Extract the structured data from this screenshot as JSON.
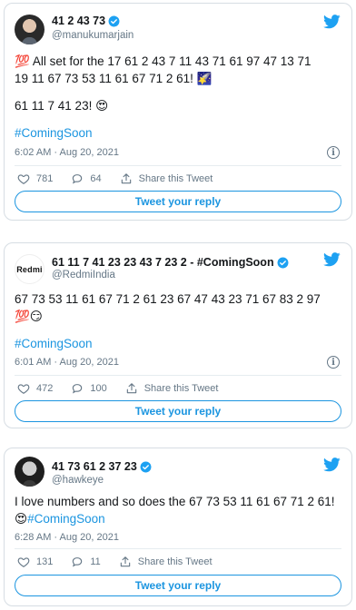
{
  "colors": {
    "accent": "#1b95e0",
    "text": "#14171a",
    "muted": "#657786",
    "border": "#d6dde3"
  },
  "tweets": [
    {
      "author": "41 2 43 73",
      "handle": "@manukumarjain",
      "text_line1": "💯 All set for the 17 61 2 43 7  11 43 71 61 97  47 13  71",
      "text_line2": "19 11  67 73 53 11 61 67 71 2 61! 🌠",
      "text_line3": "61 11 7 41 23! 😍",
      "hashtag": "#ComingSoon",
      "time": "6:02 AM · Aug 20, 2021",
      "likes": "781",
      "replies": "64",
      "share": "Share this Tweet",
      "reply_button": "Tweet your reply"
    },
    {
      "author": "61 11 7 41 23 23 43 7 23 2 - #ComingSoon",
      "handle": "@RedmiIndia",
      "avatar_text": "Redmi",
      "text_line1": "67 73 53 11 61 67 71 2 61  23 67  47 43  23 71 67  83 2 97",
      "text_line2": "💯😏",
      "hashtag": "#ComingSoon",
      "time": "6:01 AM · Aug 20, 2021",
      "likes": "472",
      "replies": "100",
      "share": "Share this Tweet",
      "reply_button": "Tweet your reply"
    },
    {
      "author": "41 73 61 2 37 23",
      "handle": "@hawkeye",
      "text_line1": "I love numbers and so does the 67 73 53 11 61 67 71 2 61!",
      "text_line2_emoji": "😍",
      "hashtag": "#ComingSoon",
      "time": "6:28 AM · Aug 20, 2021",
      "likes": "131",
      "replies": "11",
      "share": "Share this Tweet",
      "reply_button": "Tweet your reply"
    }
  ]
}
